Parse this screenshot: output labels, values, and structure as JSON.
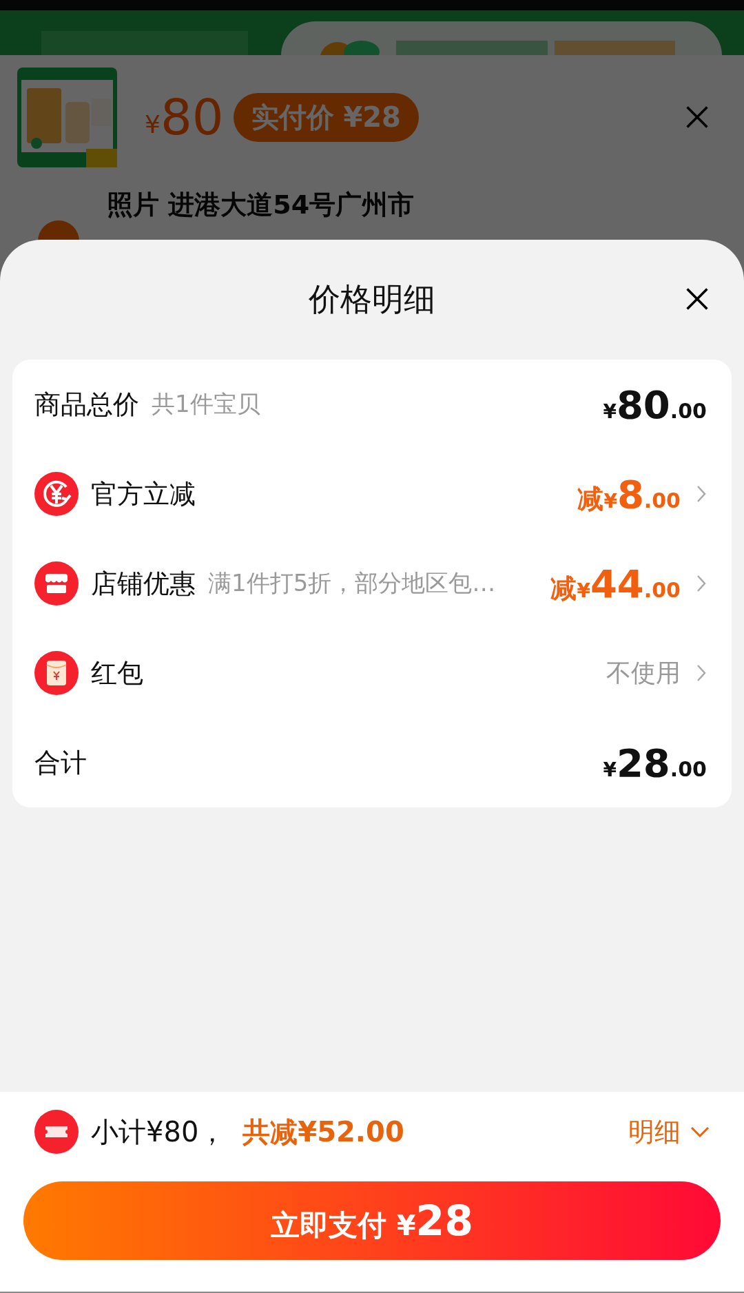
{
  "product": {
    "currency": "¥",
    "price": "80",
    "badge": "实付价 ¥28"
  },
  "address": "照片 进港大道54号广州市",
  "sheet": {
    "title": "价格明细"
  },
  "rows": [
    {
      "kind": "total",
      "label": "商品总价",
      "note": "共1件宝贝",
      "value": {
        "currency": "¥",
        "whole": "80",
        "fraction": ".00"
      }
    },
    {
      "kind": "discount",
      "label": "官方立减",
      "value": {
        "prefix": "减",
        "currency": "¥",
        "whole": "8",
        "fraction": ".00"
      }
    },
    {
      "kind": "discount",
      "label": "店铺优惠",
      "note": "满1件打5折，部分地区包…",
      "value": {
        "prefix": "减",
        "currency": "¥",
        "whole": "44",
        "fraction": ".00"
      }
    },
    {
      "kind": "option",
      "label": "红包",
      "text": "不使用"
    },
    {
      "kind": "total",
      "label": "合计",
      "value": {
        "currency": "¥",
        "whole": "28",
        "fraction": ".00"
      }
    }
  ],
  "footer": {
    "subtotal": "小计¥80，",
    "saved": "共减¥52.00",
    "detail": "明细",
    "pay_label": "立即支付",
    "pay_currency": "¥",
    "pay_amount": "28"
  }
}
